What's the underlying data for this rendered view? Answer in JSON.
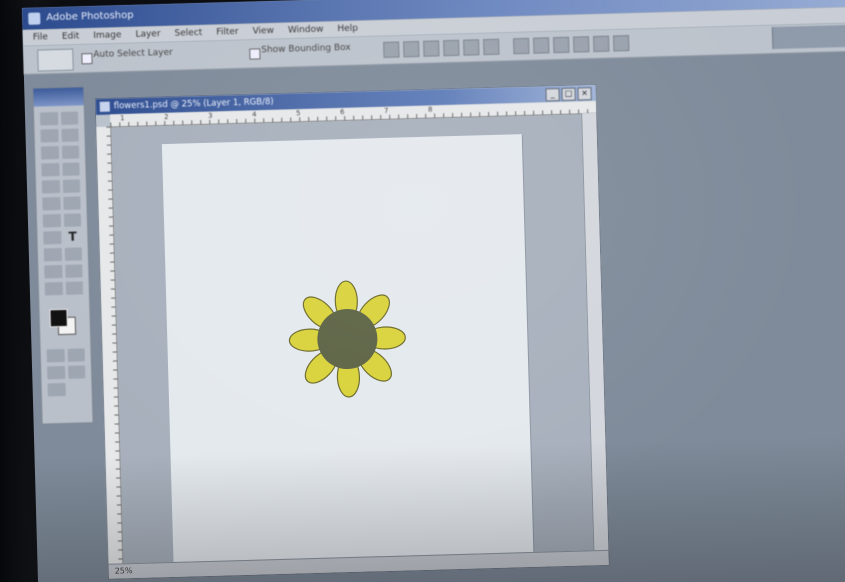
{
  "app": {
    "title": "Adobe Photoshop"
  },
  "menu": [
    "File",
    "Edit",
    "Image",
    "Layer",
    "Select",
    "Filter",
    "View",
    "Window",
    "Help"
  ],
  "options_bar": {
    "auto_select_label": "Auto Select Layer",
    "show_bounding_label": "Show Bounding Box"
  },
  "toolbox": {
    "text_tool_glyph": "T"
  },
  "document": {
    "title": "flowers1.psd @ 25% (Layer 1, RGB/8)",
    "window_buttons": [
      "_",
      "□",
      "×"
    ],
    "zoom": "25%",
    "ruler_numbers": [
      "1",
      "2",
      "3",
      "4",
      "5",
      "6",
      "7",
      "8"
    ]
  },
  "artwork": {
    "petal_color": "#d9d23a",
    "petal_outline": "#6b6a2a",
    "center_color": "#5c6243",
    "canvas_color": "#e4e9ee"
  }
}
